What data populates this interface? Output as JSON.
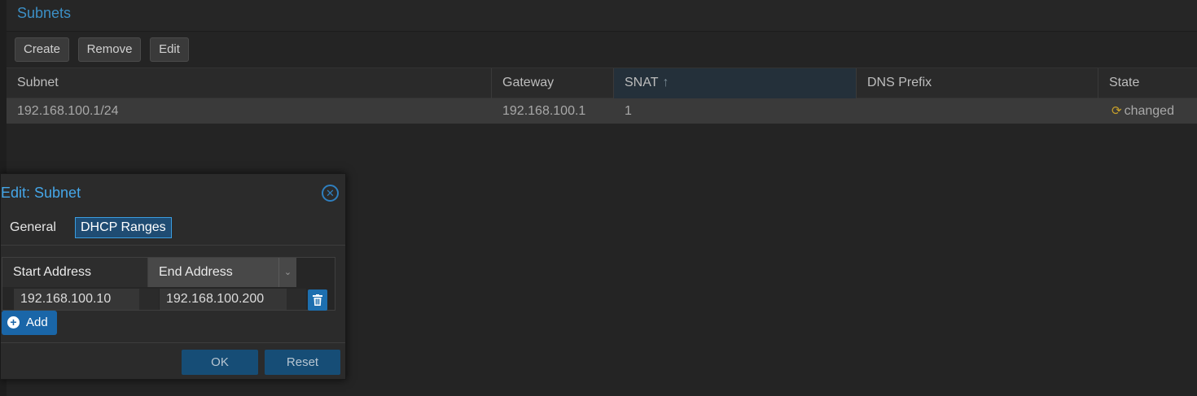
{
  "panel": {
    "title": "Subnets"
  },
  "toolbar": {
    "create_label": "Create",
    "remove_label": "Remove",
    "edit_label": "Edit"
  },
  "grid": {
    "columns": [
      {
        "label": "Subnet"
      },
      {
        "label": "Gateway"
      },
      {
        "label": "SNAT",
        "sort": "ascending"
      },
      {
        "label": "DNS Prefix"
      },
      {
        "label": "State"
      }
    ],
    "rows": [
      {
        "subnet": "192.168.100.1/24",
        "gateway": "192.168.100.1",
        "snat": "1",
        "dns_prefix": "",
        "state": "changed",
        "state_icon": "refresh-icon"
      }
    ]
  },
  "dialog": {
    "title": "Edit: Subnet",
    "tabs": [
      {
        "label": "General"
      },
      {
        "label": "DHCP Ranges",
        "active": true
      }
    ],
    "ranges": {
      "columns": [
        {
          "label": "Start Address"
        },
        {
          "label": "End Address"
        }
      ],
      "rows": [
        {
          "start": "192.168.100.10",
          "end": "192.168.100.200"
        }
      ]
    },
    "add_label": "Add",
    "ok_label": "OK",
    "reset_label": "Reset"
  },
  "colors": {
    "accent": "#3c8fc5",
    "button_primary": "#1a66a8",
    "state_warning": "#c8a02a",
    "background": "#242424"
  }
}
